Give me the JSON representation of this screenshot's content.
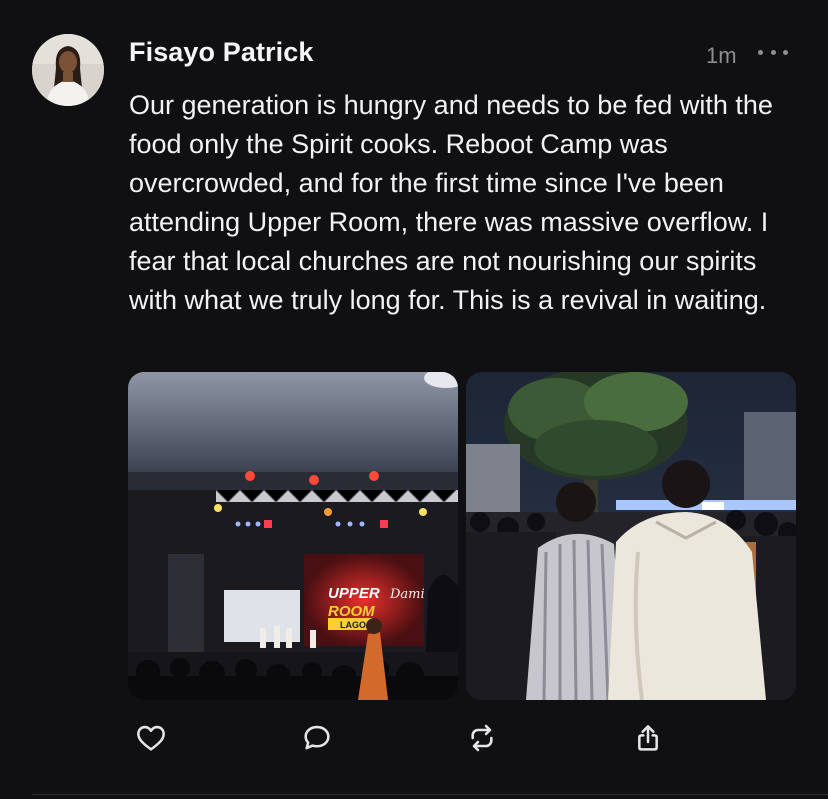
{
  "post": {
    "author": "Fisayo Patrick",
    "time": "1m",
    "text": "Our generation is hungry and needs to be fed with the food only the Spirit cooks. Reboot Camp was overcrowded, and for the first time since I've been attending Upper Room, there was massive overflow. I fear that local churches are not nourishing our spirits with what we truly long for. This is a revival in waiting.",
    "images": [
      {
        "sign_line1": "UPPER",
        "sign_line2": "ROOM",
        "sign_line3": "LAGOS",
        "script": "Dami"
      }
    ]
  },
  "icons": {
    "more": "more-icon",
    "like": "heart-icon",
    "reply": "comment-icon",
    "repost": "repost-icon",
    "share": "share-icon"
  },
  "colors": {
    "background": "#101012",
    "text": "#f2f2f4",
    "muted": "#8e8e93"
  }
}
